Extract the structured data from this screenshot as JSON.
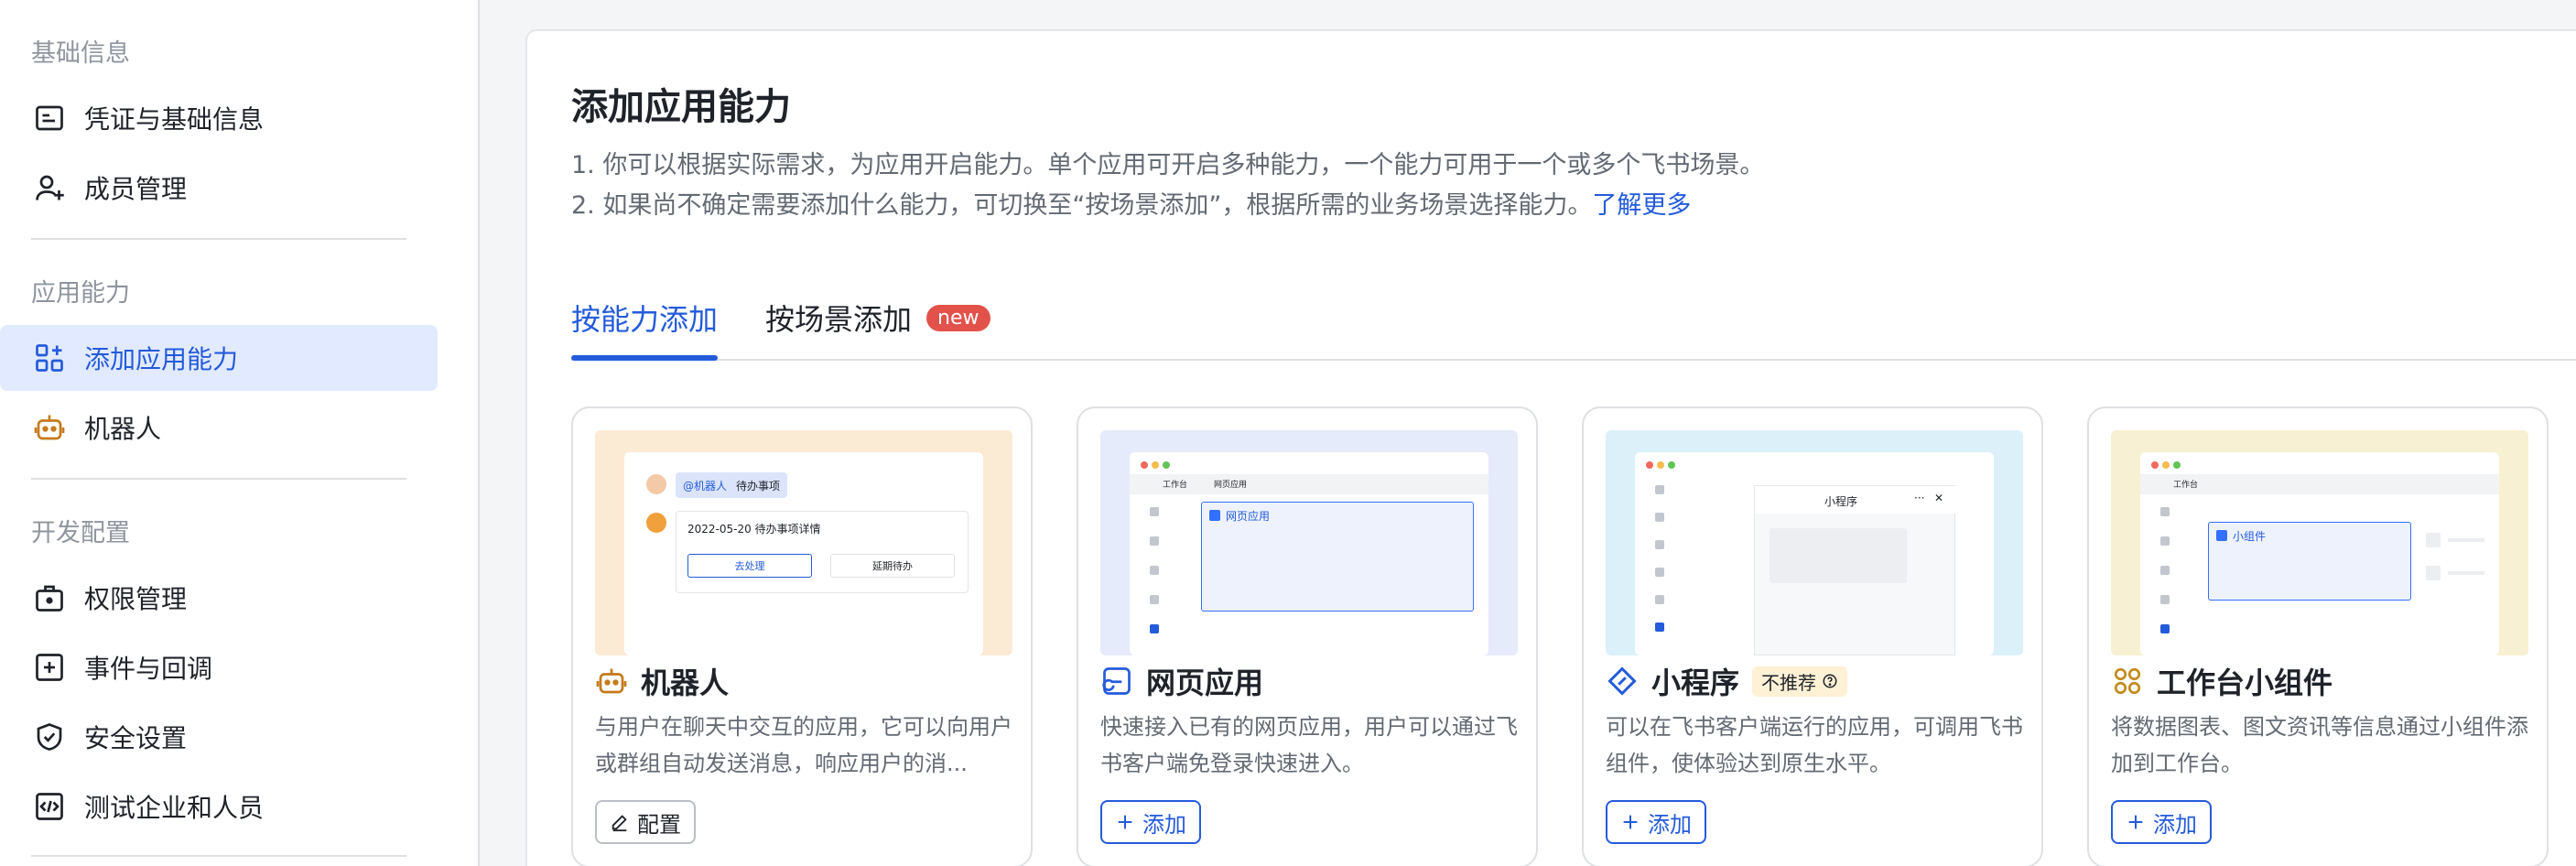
{
  "sidebar": {
    "sections": [
      {
        "title": "基础信息",
        "items": [
          "凭证与基础信息",
          "成员管理"
        ]
      },
      {
        "title": "应用能力",
        "items": [
          "添加应用能力",
          "机器人"
        ]
      },
      {
        "title": "开发配置",
        "items": [
          "权限管理",
          "事件与回调",
          "安全设置",
          "测试企业和人员"
        ]
      }
    ],
    "active_item": "添加应用能力"
  },
  "main": {
    "title": "添加应用能力",
    "desc_line1": "1. 你可以根据实际需求，为应用开启能力。单个应用可开启多种能力，一个能力可用于一个或多个飞书场景。",
    "desc_line2": "2. 如果尚不确定需要添加什么能力，可切换至“按场景添加”，根据所需的业务场景选择能力。",
    "learn_more": "了解更多",
    "tabs": [
      {
        "label": "按能力添加",
        "active": true
      },
      {
        "label": "按场景添加",
        "badge": "new"
      }
    ],
    "cards": [
      {
        "title": "机器人",
        "icon": "robot-icon",
        "desc": "与用户在聊天中交互的应用，它可以向用户或群组自动发送消息，响应用户的消...",
        "button": "配置",
        "button_icon": "edit-icon",
        "preview": {
          "mention": "@机器人",
          "todo": "待办事项",
          "detail": "2022-05-20 待办事项详情",
          "btn_left": "去处理",
          "btn_right": "延期待办"
        }
      },
      {
        "title": "网页应用",
        "icon": "web-app-icon",
        "desc": "快速接入已有的网页应用，用户可以通过飞书客户端免登录快速进入。",
        "button": "添加",
        "button_icon": "plus-icon",
        "preview": {
          "tab1": "工作台",
          "tab2": "网页应用",
          "content": "网页应用"
        }
      },
      {
        "title": "小程序",
        "icon": "mini-program-icon",
        "tag": "不推荐",
        "desc": "可以在飞书客户端运行的应用，可调用飞书组件，使体验达到原生水平。",
        "button": "添加",
        "button_icon": "plus-icon",
        "preview": {
          "header": "小程序"
        }
      },
      {
        "title": "工作台小组件",
        "icon": "widget-icon",
        "desc": "将数据图表、图文资讯等信息通过小组件添加到工作台。",
        "button": "添加",
        "button_icon": "plus-icon",
        "preview": {
          "tab1": "工作台",
          "content": "小组件"
        }
      }
    ]
  },
  "colors": {
    "accent": "#245bdb",
    "active_bg": "#e1eaff",
    "badge_new": "#e2524a",
    "robot_orange": "#c57a1c",
    "robot_preview_bg": "#fbead4",
    "web_preview_bg": "#e5ebfa",
    "mini_preview_bg": "#dcf0fa",
    "widget_preview_bg": "#f8f0d2"
  }
}
